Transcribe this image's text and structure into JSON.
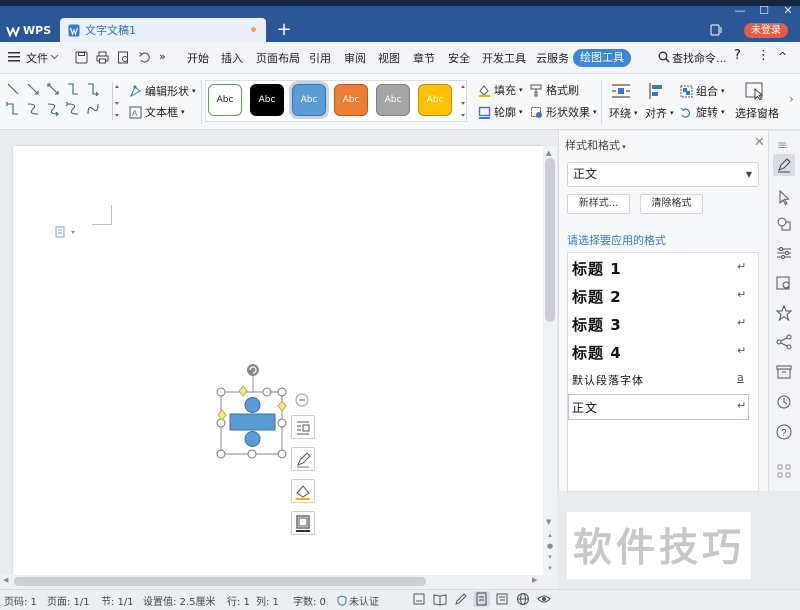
{
  "titlebar": {
    "app_name": "WPS",
    "document_tab": "文字文稿1",
    "new_tab": "+",
    "login_button": "未登录",
    "window_controls": [
      "—",
      "☐",
      "✕"
    ]
  },
  "menubar": {
    "file": "文件",
    "more": "»",
    "items": [
      "开始",
      "插入",
      "页面布局",
      "引用",
      "审阅",
      "视图",
      "章节",
      "安全",
      "开发工具",
      "云服务"
    ],
    "active_tab": "绘图工具",
    "search": "查找命令...",
    "help": "?",
    "menu": "⋮",
    "collapse": "^"
  },
  "ribbon": {
    "edit_shape": "编辑形状",
    "text_box": "文本框",
    "shape_styles": [
      {
        "label": "Abc",
        "bg": "#ffffff",
        "fg": "#222222",
        "border": "#5aa05a"
      },
      {
        "label": "Abc",
        "bg": "#000000",
        "fg": "#ffffff",
        "border": "#000000"
      },
      {
        "label": "Abc",
        "bg": "#5b9bd5",
        "fg": "#ffffff",
        "border": "#2e75b6"
      },
      {
        "label": "Abc",
        "bg": "#ed7d31",
        "fg": "#ffffff",
        "border": "#c55a11"
      },
      {
        "label": "Abc",
        "bg": "#a5a5a5",
        "fg": "#ffffff",
        "border": "#7f7f7f"
      },
      {
        "label": "Abc",
        "bg": "#ffc000",
        "fg": "#ffffff",
        "border": "#bf9000"
      }
    ],
    "fill": "填充",
    "format_painter": "格式刷",
    "outline": "轮廓",
    "shape_effects": "形状效果",
    "wrap": "环绕",
    "align": "对齐",
    "group": "组合",
    "rotate": "旋转",
    "selection_pane": "选择窗格"
  },
  "side_panel": {
    "title": "样式和格式",
    "current_style": "正文",
    "new_style_button": "新样式...",
    "clear_format_button": "清除格式",
    "apply_prompt": "请选择要应用的格式",
    "styles": [
      {
        "label": "标题 1",
        "mark": "↵"
      },
      {
        "label": "标题 2",
        "mark": "↵"
      },
      {
        "label": "标题 3",
        "mark": "↵"
      },
      {
        "label": "标题 4",
        "mark": "↵"
      },
      {
        "label": "默认段落字体",
        "mark": "a"
      },
      {
        "label": "正文",
        "mark": "↵"
      }
    ]
  },
  "watermark": "软件技巧",
  "statusbar": {
    "page_num": "页码: 1",
    "pages": "页面: 1/1",
    "section": "节: 1/1",
    "setting": "设置值: 2.5厘米",
    "row": "行: 1",
    "col": "列: 1",
    "words": "字数: 0",
    "auth": "未认证"
  },
  "colors": {
    "titlebar": "#2b5797",
    "accent": "#3a86d8",
    "shape_fill": "#5b9bd5"
  }
}
